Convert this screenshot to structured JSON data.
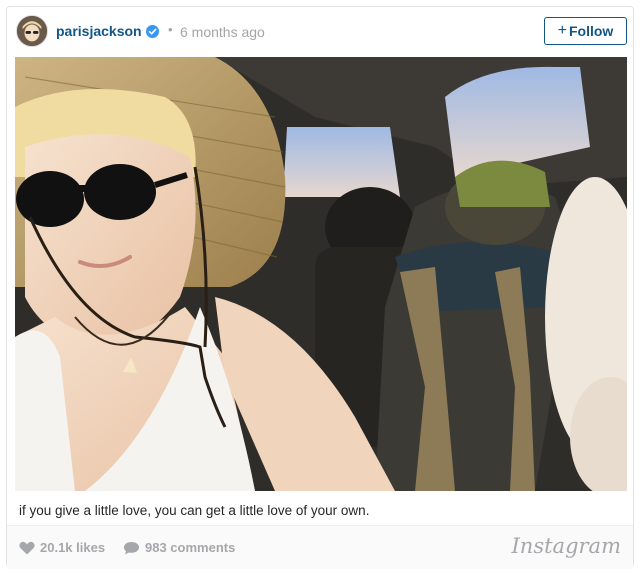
{
  "post": {
    "username": "parisjackson",
    "dot": "•",
    "time_ago": "6 months ago",
    "follow_label": "Follow",
    "follow_plus": "+",
    "caption": "if you give a little love, you can get a little love of your own.",
    "likes": "20.1k likes",
    "comments": "983 comments"
  },
  "brand": {
    "name": "Instagram"
  },
  "colors": {
    "link": "#125688",
    "muted": "#a5a7aa",
    "verified": "#3897f0"
  },
  "icons": {
    "verified": "verified-badge-icon",
    "heart": "heart-icon",
    "comment": "comment-bubble-icon"
  }
}
